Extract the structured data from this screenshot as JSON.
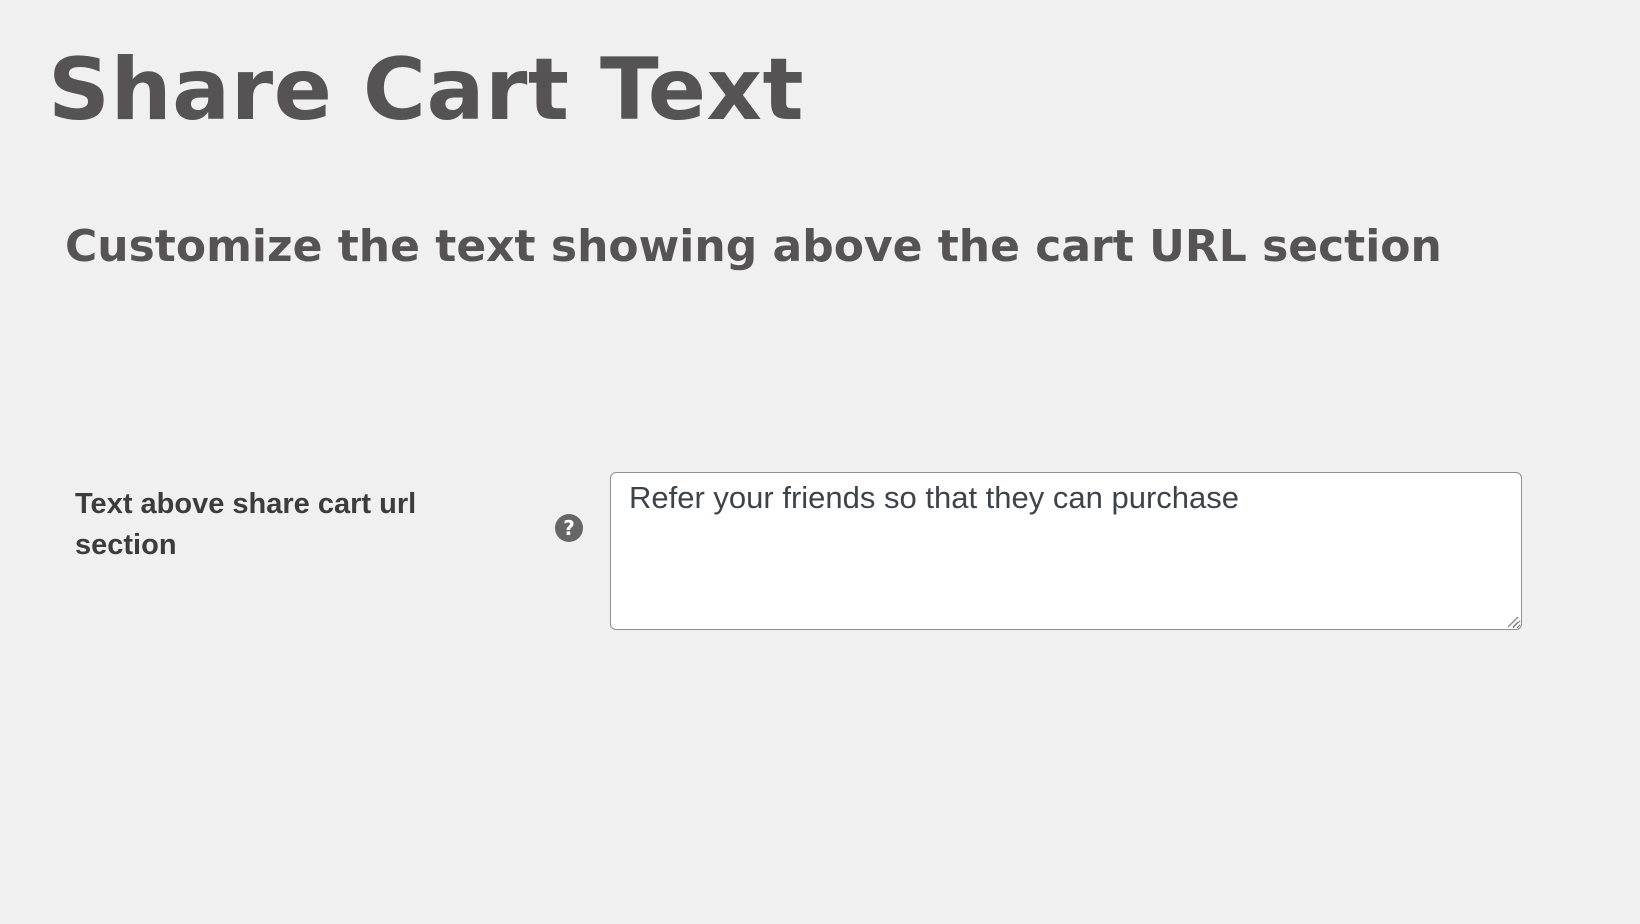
{
  "page": {
    "title": "Share Cart Text",
    "subtitle": "Customize the text showing above the cart URL section"
  },
  "setting": {
    "label": "Text above share cart url section",
    "help_icon": "question-circle-icon",
    "help_glyph": "?",
    "value": "Refer your friends so that they can purchase"
  },
  "colors": {
    "background": "#f0f0f0",
    "heading": "#555353",
    "label": "#3c3c3c",
    "help_icon": "#666666",
    "textarea_border": "#8c8f94"
  }
}
